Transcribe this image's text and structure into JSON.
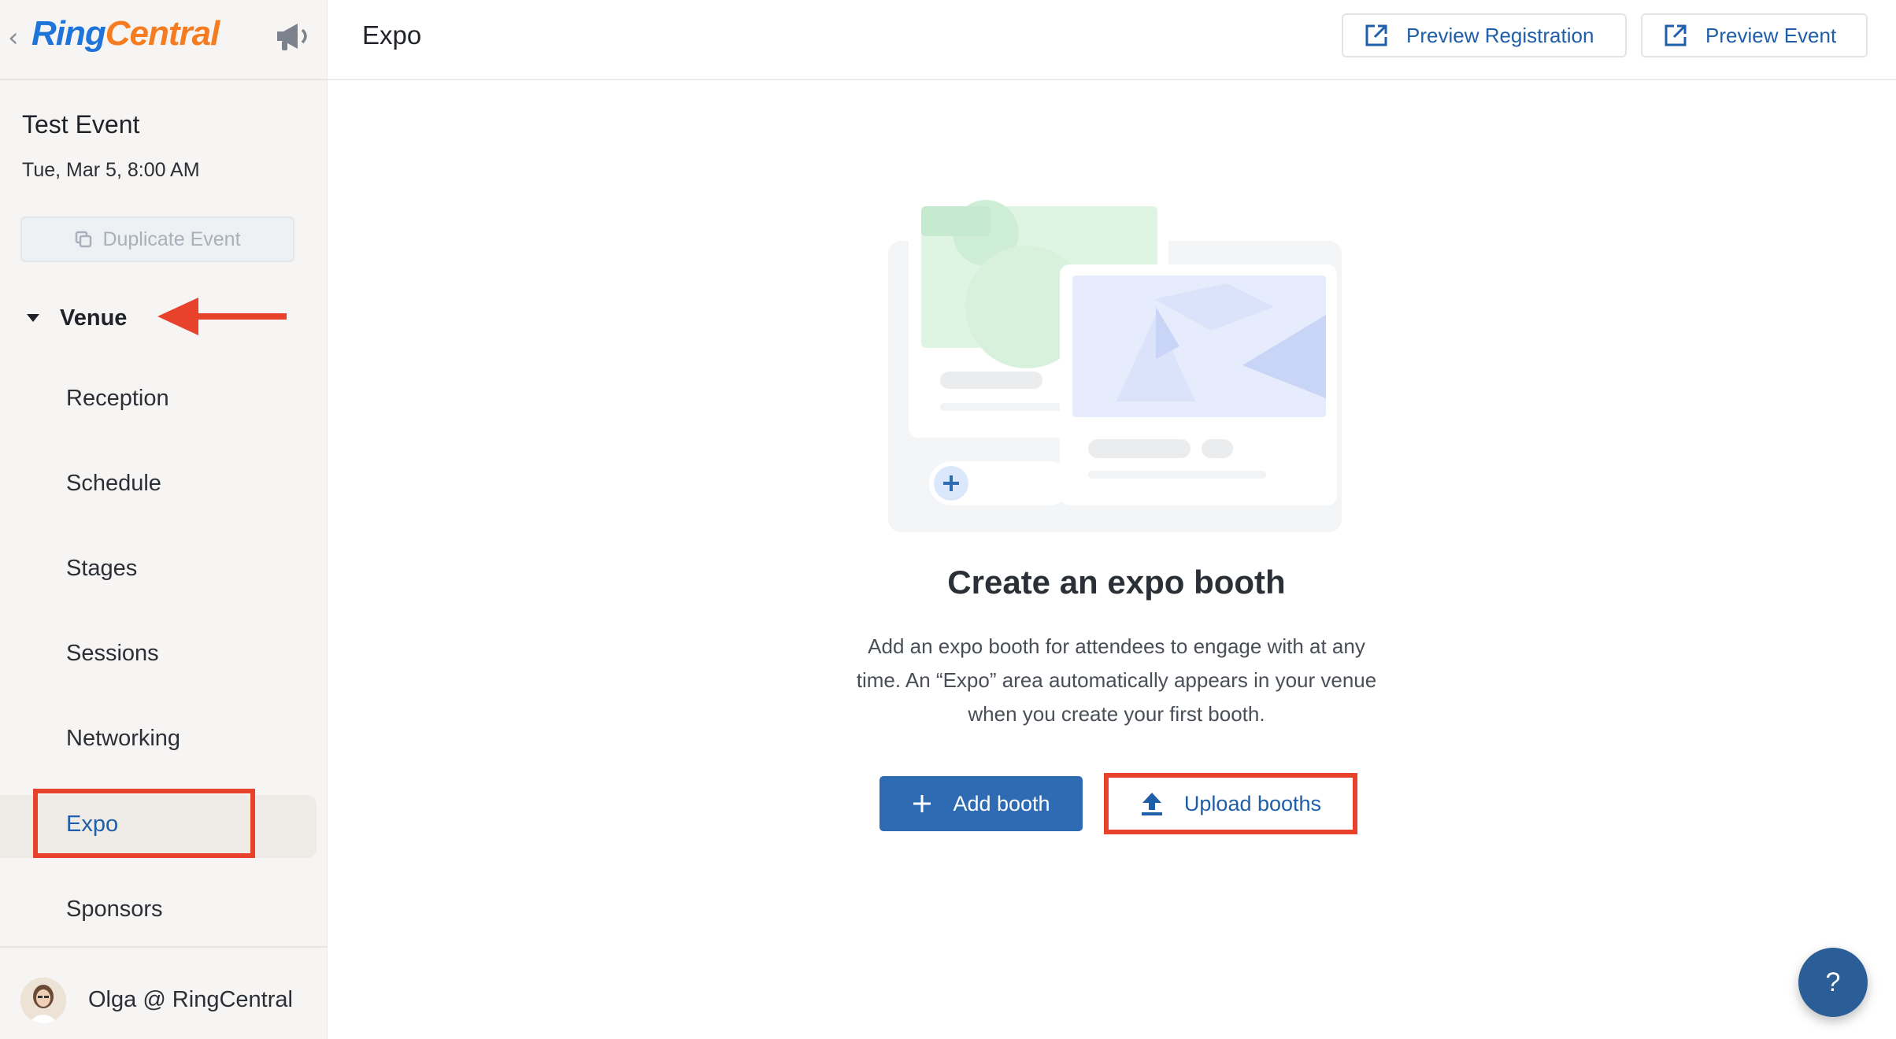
{
  "sidebar": {
    "logo": {
      "ring": "Ring",
      "central": "Central"
    },
    "event_title": "Test Event",
    "event_date": "Tue, Mar 5, 8:00 AM",
    "duplicate_label": "Duplicate Event",
    "venue_label": "Venue",
    "nav_items": [
      "Reception",
      "Schedule",
      "Stages",
      "Sessions",
      "Networking",
      "Expo",
      "Sponsors"
    ],
    "active_item": "Expo",
    "user_name": "Olga @ RingCentral"
  },
  "header": {
    "title": "Expo",
    "preview_registration": "Preview Registration",
    "preview_event": "Preview Event"
  },
  "main": {
    "empty_title": "Create an expo booth",
    "empty_desc_lines": [
      "Add an expo booth for attendees to engage with at any",
      "time. An “Expo” area automatically appears in your venue",
      "when you create your first booth."
    ],
    "add_booth_label": "Add booth",
    "upload_booths_label": "Upload booths"
  },
  "help": {
    "label": "?"
  },
  "colors": {
    "accent": "#1f5ea8",
    "primary_button": "#2e6bb3",
    "highlight": "#e8412c",
    "logo_blue": "#1e74d8",
    "logo_orange": "#f57c20"
  },
  "icons": {
    "back": "chevron-left-icon",
    "announce": "megaphone-icon",
    "duplicate": "copy-icon",
    "external": "external-link-icon",
    "add": "plus-icon",
    "upload": "upload-icon"
  }
}
